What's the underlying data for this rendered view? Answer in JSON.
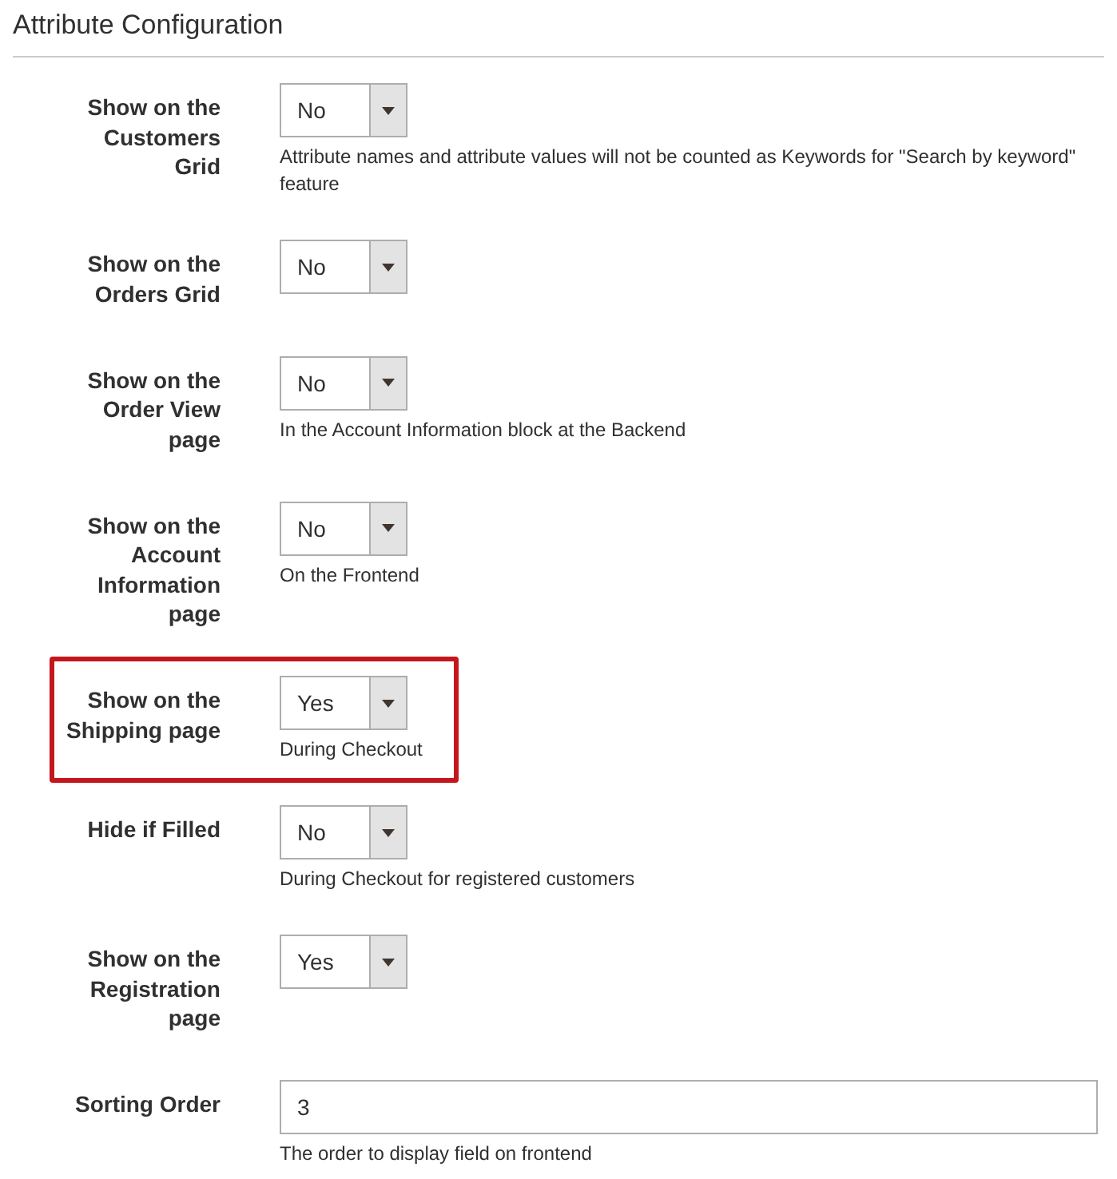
{
  "section": {
    "title": "Attribute Configuration"
  },
  "rows": [
    {
      "label": "Show on the Customers Grid",
      "kind": "select",
      "value": "No",
      "note": "Attribute names and attribute values will not be counted as Keywords for \"Search by keyword\" feature",
      "highlighted": false
    },
    {
      "label": "Show on the Orders Grid",
      "kind": "select",
      "value": "No",
      "highlighted": false
    },
    {
      "label": "Show on the Order View page",
      "kind": "select",
      "value": "No",
      "note": "In the Account Information block at the Backend",
      "highlighted": false
    },
    {
      "label": "Show on the Account Information page",
      "kind": "select",
      "value": "No",
      "note": "On the Frontend",
      "highlighted": false
    },
    {
      "label": "Show on the Shipping page",
      "kind": "select",
      "value": "Yes",
      "note": "During Checkout",
      "highlighted": true
    },
    {
      "label": "Hide if Filled",
      "kind": "select",
      "value": "No",
      "note": "During Checkout for registered customers",
      "highlighted": false
    },
    {
      "label": "Show on the Registration page",
      "kind": "select",
      "value": "Yes",
      "highlighted": false
    },
    {
      "label": "Sorting Order",
      "kind": "text",
      "value": "3",
      "note": "The order to display field on frontend",
      "highlighted": false
    }
  ]
}
